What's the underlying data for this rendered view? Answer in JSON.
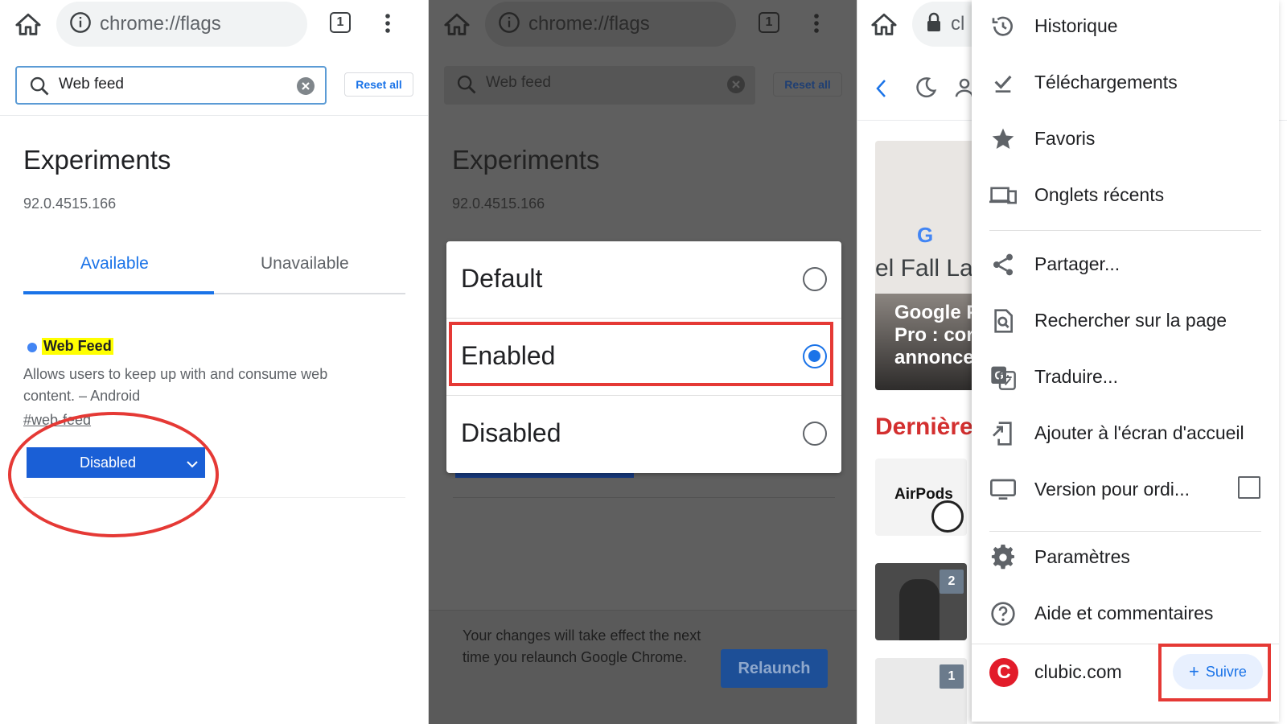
{
  "panel1": {
    "omnibox_url": "chrome://flags",
    "tab_count": "1",
    "search_value": "Web feed",
    "reset_label": "Reset all",
    "heading": "Experiments",
    "version": "92.0.4515.166",
    "tabs": [
      "Available",
      "Unavailable"
    ],
    "flag": {
      "name": "Web Feed",
      "description": "Allows users to keep up with and consume web content. – Android",
      "link": "#web-feed",
      "select_value": "Disabled"
    }
  },
  "panel2": {
    "omnibox_url": "chrome://flags",
    "tab_count": "1",
    "search_value": "Web feed",
    "reset_label": "Reset all",
    "heading": "Experiments",
    "version": "92.0.4515.166",
    "options": [
      {
        "label": "Default",
        "selected": false
      },
      {
        "label": "Enabled",
        "selected": true
      },
      {
        "label": "Disabled",
        "selected": false
      }
    ],
    "relaunch_text": "Your changes will take effect the next time you relaunch Google Chrome.",
    "relaunch_label": "Relaunch"
  },
  "panel3": {
    "omnibox_partial": "cl",
    "page": {
      "google_letter": "G",
      "card_title": "el Fall Lau",
      "card_caption_lines": [
        "Google P",
        "Pro : cor",
        "annonce"
      ],
      "section_title": "Dernière",
      "thumb1_text": "AirPods",
      "thumb2_badge": "2",
      "thumb3_badge": "1"
    },
    "menu": {
      "items": [
        {
          "label": "Historique",
          "icon": "history-icon"
        },
        {
          "label": "Téléchargements",
          "icon": "download-done-icon"
        },
        {
          "label": "Favoris",
          "icon": "star-icon"
        },
        {
          "label": "Onglets récents",
          "icon": "devices-icon"
        },
        {
          "label": "Partager...",
          "icon": "share-icon"
        },
        {
          "label": "Rechercher sur la page",
          "icon": "find-in-page-icon"
        },
        {
          "label": "Traduire...",
          "icon": "translate-icon"
        },
        {
          "label": "Ajouter à l'écran d'accueil",
          "icon": "add-to-home-icon"
        },
        {
          "label": "Version pour ordi...",
          "icon": "desktop-icon"
        },
        {
          "label": "Paramètres",
          "icon": "gear-icon"
        },
        {
          "label": "Aide et commentaires",
          "icon": "help-icon"
        }
      ],
      "site_name": "clubic.com",
      "site_logo_letter": "C",
      "follow_label": "Suivre"
    }
  },
  "colors": {
    "accent": "#1a73e8",
    "highlight_red": "#e53935",
    "flag_highlight": "#ffff00"
  }
}
